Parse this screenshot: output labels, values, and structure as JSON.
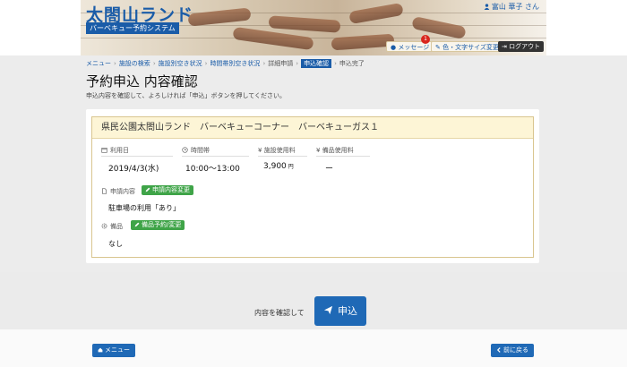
{
  "header": {
    "title": "太閤山ランド",
    "subtitle": "バーベキュー予約システム",
    "user": "富山 華子 さん",
    "message_label": "メッセージ",
    "message_count": "1",
    "style_label": "色・文字サイズ変更",
    "logout_label": "ログアウト"
  },
  "breadcrumb": [
    "メニュー",
    "施設の検索",
    "施設別空き状況",
    "時間帯別空き状況",
    "詳細申請",
    "申込確認",
    "申込完了"
  ],
  "page": {
    "title": "予約申込 内容確認",
    "description": "申込内容を確認して、よろしければ「申込」ボタンを押してください。"
  },
  "reservation": {
    "facility": "県民公園太閤山ランド　バーベキューコーナー　バーベキューガス１",
    "date_label": "利用日",
    "date": "2019/4/3(水)",
    "time_label": "時間帯",
    "time": "10:00〜13:00",
    "fee_label": "施設使用料",
    "fee": "3,900",
    "fee_unit": "円",
    "equip_fee_label": "備品使用料",
    "equip_fee": "ー",
    "request_label": "申請内容",
    "request_change_button": "申請内容変更",
    "request_value": "駐車場の利用「あり」",
    "equipment_label": "備品",
    "equipment_button": "備品予約/変更",
    "equipment_value": "なし"
  },
  "actions": {
    "confirm_text": "内容を確認して",
    "submit_label": "申込",
    "menu_label": "メニュー",
    "back_label": "前に戻る"
  },
  "colors": {
    "primary": "#1f69b6",
    "accent_green": "#3fa448",
    "card_header": "#fdf5d6",
    "badge": "#d9251d"
  }
}
